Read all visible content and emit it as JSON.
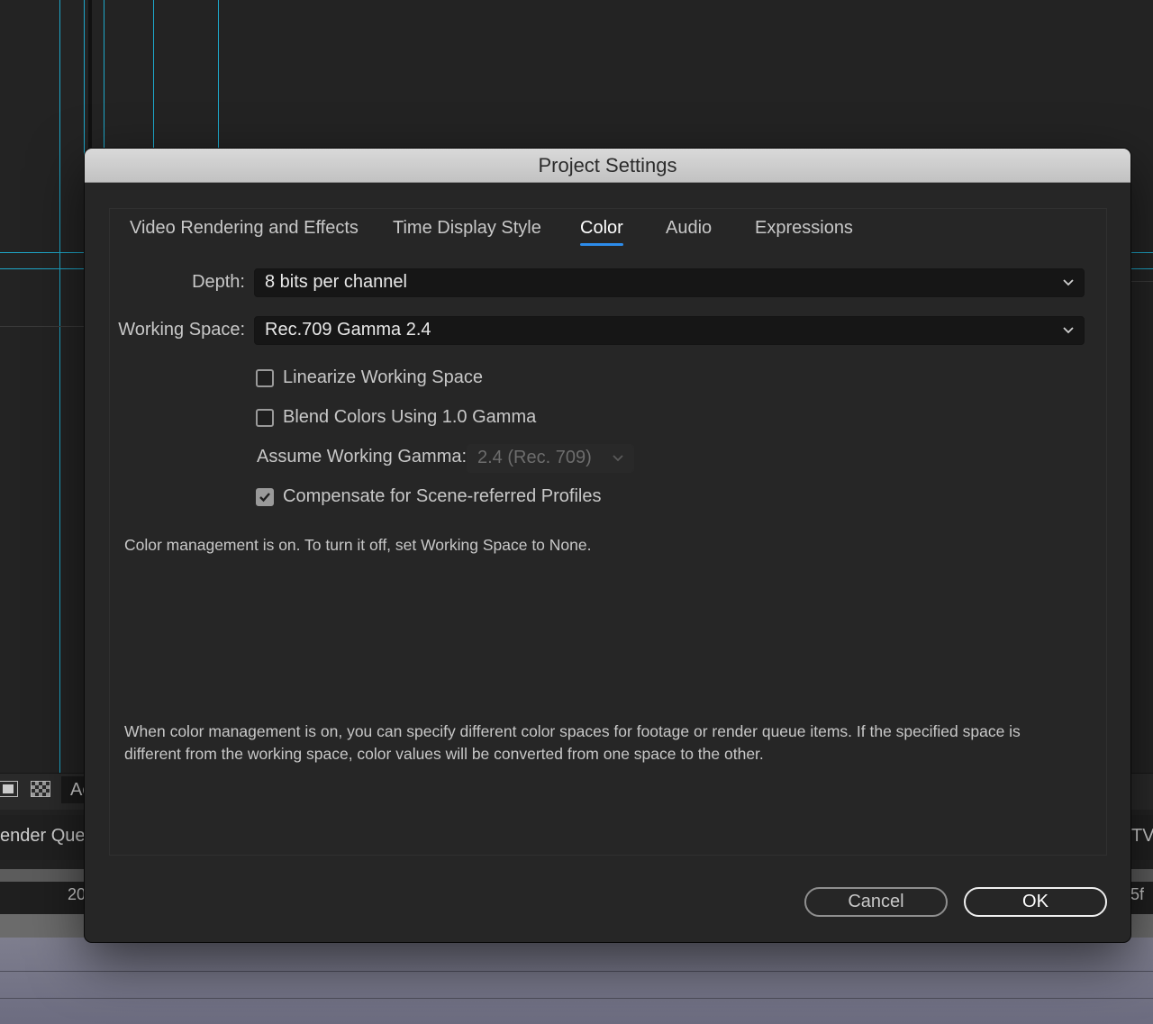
{
  "background": {
    "toolbar_text": "Ac",
    "tab_text": "ender Queu",
    "right_tab_text": "TV-",
    "ruler_left": "20",
    "ruler_right": "5f"
  },
  "dialog": {
    "title": "Project Settings",
    "tabs": [
      {
        "label": "Video Rendering and Effects",
        "active": false
      },
      {
        "label": "Time Display Style",
        "active": false
      },
      {
        "label": "Color",
        "active": true
      },
      {
        "label": "Audio",
        "active": false
      },
      {
        "label": "Expressions",
        "active": false
      }
    ],
    "depth": {
      "label": "Depth:",
      "value": "8 bits per channel"
    },
    "working_space": {
      "label": "Working Space:",
      "value": "Rec.709 Gamma 2.4"
    },
    "checkboxes": [
      {
        "label": "Linearize Working Space",
        "checked": false
      },
      {
        "label": "Blend Colors Using 1.0 Gamma",
        "checked": false
      }
    ],
    "assume_gamma": {
      "label": "Assume Working Gamma:",
      "value": "2.4 (Rec. 709)",
      "enabled": false
    },
    "compensate": {
      "label": "Compensate for Scene-referred Profiles",
      "checked": true
    },
    "status_text": "Color management is on. To turn it off, set Working Space to None.",
    "help_text_line1": "When color management is on, you can specify different color spaces for footage or render queue items. If the specified space is",
    "help_text_line2": "different from the working space, color values will be converted from one space to the other.",
    "buttons": {
      "cancel": "Cancel",
      "ok": "OK"
    }
  },
  "colors": {
    "accent": "#2d8ceb",
    "guide_lines": "#1ea7c9",
    "dialog_bg": "#262626",
    "titlebar": "#cfcfcf"
  }
}
